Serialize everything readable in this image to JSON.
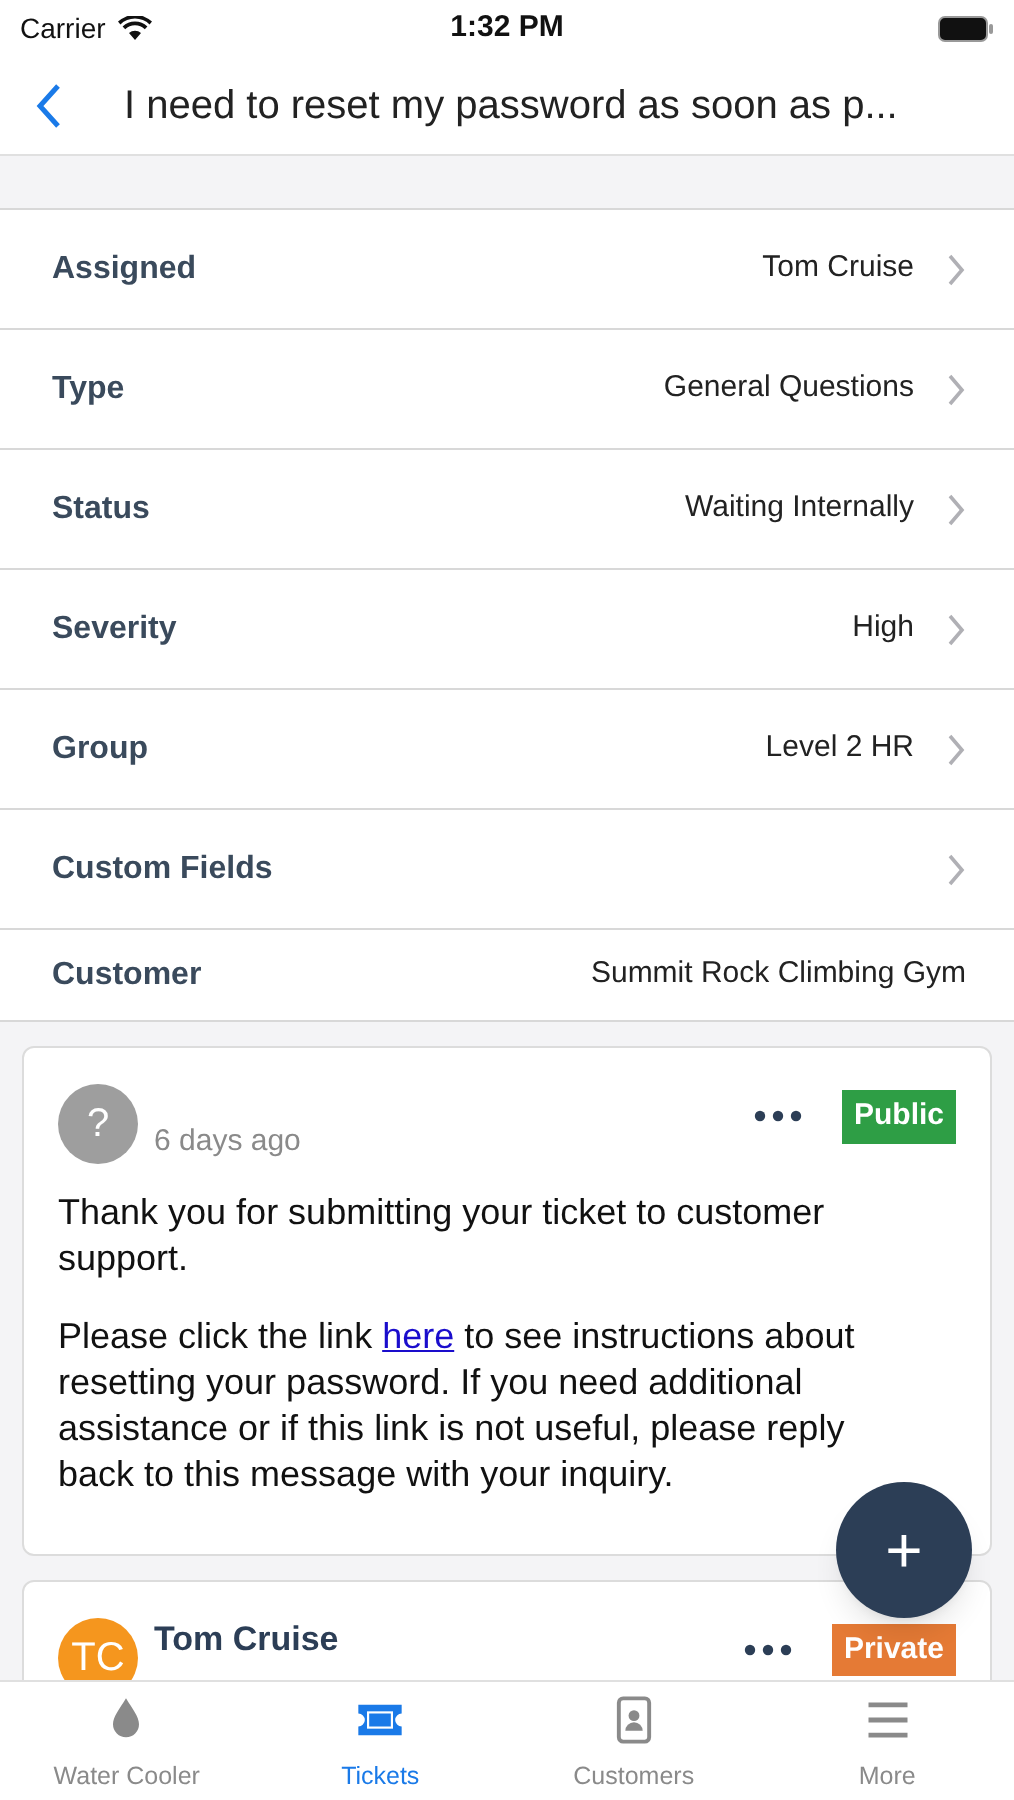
{
  "status_bar": {
    "carrier": "Carrier",
    "time": "1:32 PM"
  },
  "nav": {
    "title": "I need to reset my password as soon as p..."
  },
  "fields": [
    {
      "label": "Assigned",
      "value": "Tom Cruise",
      "kind": "link"
    },
    {
      "label": "Type",
      "value": "General Questions",
      "kind": "link"
    },
    {
      "label": "Status",
      "value": "Waiting Internally",
      "kind": "link"
    },
    {
      "label": "Severity",
      "value": "High",
      "kind": "link"
    },
    {
      "label": "Group",
      "value": "Level 2 HR",
      "kind": "link"
    },
    {
      "label": "Custom Fields",
      "kind": "link"
    },
    {
      "label": "Customer",
      "value": "Summit Rock Climbing Gym",
      "kind": "plain"
    }
  ],
  "messages": [
    {
      "kind": "unknown",
      "avatar": "?",
      "time": "6 days ago",
      "badge": "Public",
      "color": "#2e9e45",
      "paragraphs": [
        {
          "text": "Thank you for submitting your ticket to customer support."
        },
        {
          "before": "Please click the link ",
          "link": "here",
          "after": " to see instructions about resetting your password. If you need additional assistance or if this link is not useful, please reply back to this message with your inquiry."
        }
      ]
    },
    {
      "kind": "agent",
      "avatar": "TC",
      "author": "Tom Cruise",
      "badge": "Private",
      "color": "#e57a35"
    }
  ],
  "fab": {
    "label": "+"
  },
  "tabs": [
    {
      "label": "Water Cooler",
      "selected": false
    },
    {
      "label": "Tickets",
      "selected": true
    },
    {
      "label": "Customers",
      "selected": false
    },
    {
      "label": "More",
      "selected": false
    }
  ]
}
